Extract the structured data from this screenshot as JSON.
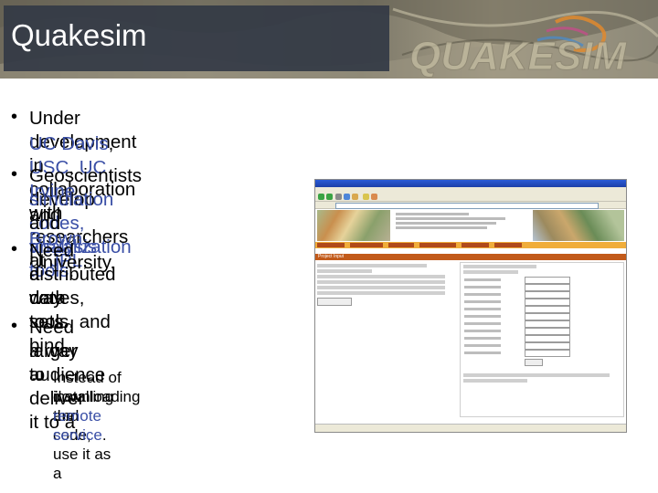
{
  "header": {
    "title": "Quakesim",
    "logo_text": "QUAKESIM"
  },
  "bullets": [
    {
      "parts": [
        "Under development in collaboration with researchers at ",
        "JPL",
        ","
      ]
    },
    {
      "parts": [
        "UC Davis",
        ", ",
        "USC",
        ", ",
        "UC Irvine",
        ", and ",
        "Brown",
        " University."
      ]
    },
    {
      "parts": [
        "Geoscientists develop"
      ]
    },
    {
      "parts": [
        "simulation codes, analysis"
      ]
    },
    {
      "parts": [
        "and ",
        "visualization tools",
        "."
      ]
    },
    {
      "parts": [
        "Need a way to bind"
      ]
    },
    {
      "parts": [
        "distributed codes, tools, and"
      ]
    },
    {
      "parts": [
        "data sets."
      ]
    },
    {
      "parts": [
        "Need a way to deliver it to a"
      ]
    },
    {
      "parts": [
        "larger audience"
      ]
    }
  ],
  "sub_bullet": {
    "dash": "–",
    "line1": "Instead of downloading and",
    "line2": "installing the code, use it as a",
    "line3": "remote service",
    "line3_end": "."
  },
  "screenshot": {
    "page_title": "Project Input",
    "section": "Project Input"
  },
  "colors": {
    "highlight": "#3a4fa6",
    "title_bg": "#333a45"
  }
}
